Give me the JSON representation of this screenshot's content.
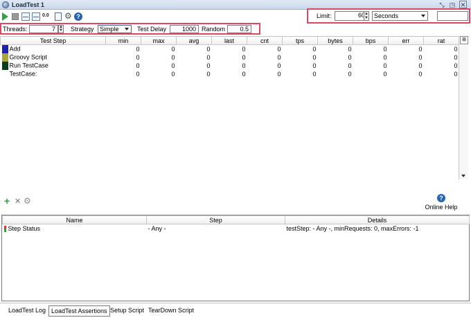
{
  "window": {
    "title": "LoadTest 1"
  },
  "limit": {
    "label": "Limit:",
    "value": "60",
    "unit": "Seconds"
  },
  "settings": {
    "threads_label": "Threads:",
    "threads_value": "7",
    "strategy_label": "Strategy",
    "strategy_value": "Simple",
    "delay_label": "Test Delay",
    "delay_value": "1000",
    "random_label": "Random",
    "random_value": "0.5"
  },
  "stats_table": {
    "columns": [
      "Test Step",
      "min",
      "max",
      "avg",
      "last",
      "cnt",
      "tps",
      "bytes",
      "bps",
      "err",
      "rat"
    ],
    "rows": [
      {
        "name": "Add",
        "color": "#1f1fb3",
        "values": [
          "0",
          "0",
          "0",
          "0",
          "0",
          "0",
          "0",
          "0",
          "0",
          "0"
        ]
      },
      {
        "name": "Groovy Script",
        "color": "#a8a832",
        "values": [
          "0",
          "0",
          "0",
          "0",
          "0",
          "0",
          "0",
          "0",
          "0",
          "0"
        ]
      },
      {
        "name": "Run TestCase",
        "color": "#0a3d1a",
        "values": [
          "0",
          "0",
          "0",
          "0",
          "0",
          "0",
          "0",
          "0",
          "0",
          "0"
        ]
      },
      {
        "name": "TestCase:",
        "color": "",
        "values": [
          "0",
          "0",
          "0",
          "0",
          "0",
          "0",
          "0",
          "0",
          "0",
          "0"
        ]
      }
    ]
  },
  "online_help": "Online Help",
  "assertions": {
    "columns": [
      "Name",
      "Step",
      "Details"
    ],
    "rows": [
      {
        "name": "Step Status",
        "step": "- Any -",
        "details": "testStep: - Any -, minRequests: 0, maxErrors: -1"
      }
    ]
  },
  "tabs": [
    {
      "label": "LoadTest Log",
      "active": false
    },
    {
      "label": "LoadTest Assertions",
      "active": true
    },
    {
      "label": "Setup Script",
      "active": false
    },
    {
      "label": "TearDown Script",
      "active": false
    }
  ],
  "icons": {
    "toolbar": [
      "play-icon",
      "stop-icon",
      "statistics-graph-icon",
      "compare-graph-icon",
      "reset-icon",
      "export-icon",
      "options-gear-icon",
      "help-icon"
    ],
    "assertion_toolbar": [
      "add-icon",
      "remove-icon",
      "configure-icon"
    ]
  }
}
